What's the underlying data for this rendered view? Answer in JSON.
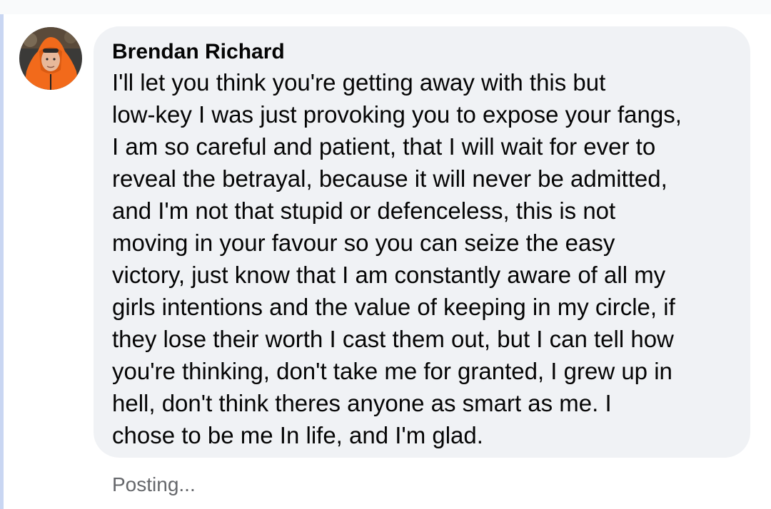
{
  "comment": {
    "author": "Brendan Richard",
    "text": "I'll let you think you're getting away with this but\nlow-key I was just provoking you to expose your fangs,\nI am so careful and patient, that I will wait for ever to\nreveal the betrayal, because it will never be admitted,\nand I'm not that stupid or defenceless, this is not\nmoving in your favour so you can seize the easy\nvictory, just know that I am constantly aware of all my\ngirls intentions and the value of keeping in my circle, if\nthey lose their worth I cast them out, but I can tell how\nyou're thinking, don't take me for granted, I grew up in\nhell, don't think theres anyone as smart as me. I\nchose to be me In life, and I'm glad.",
    "status": "Posting..."
  },
  "colors": {
    "bubble_background": "#f0f2f5",
    "thread_line": "#c9d6f2",
    "status_text": "#65676b",
    "avatar_jacket": "#f26a1b"
  },
  "icons": {
    "avatar": "user-profile-photo"
  }
}
